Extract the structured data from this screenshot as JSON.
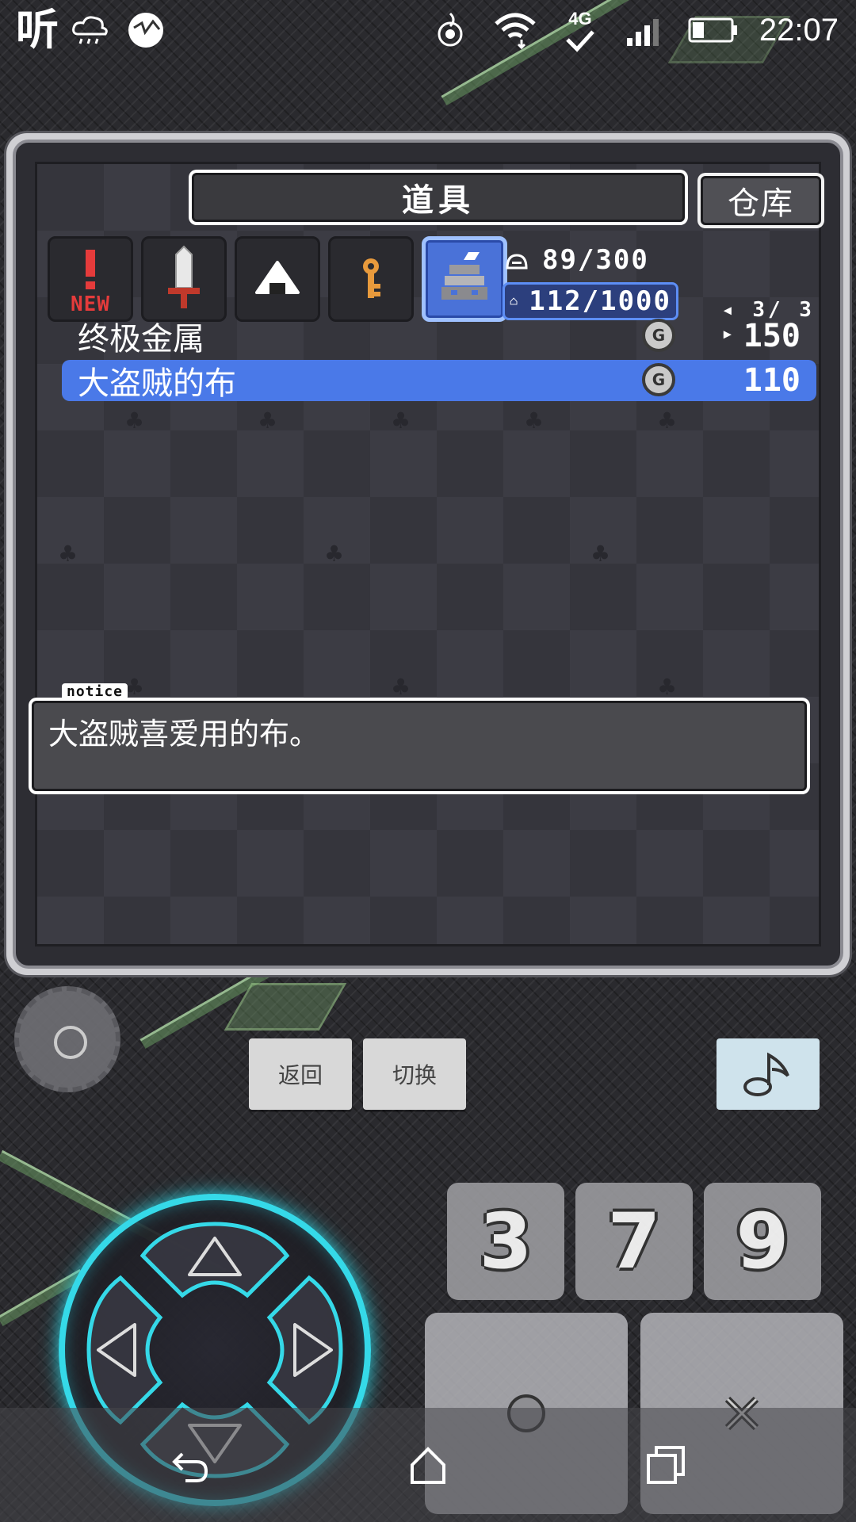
{
  "status_bar": {
    "logo": "听",
    "time": "22:07",
    "network_label": "4G",
    "icons": [
      "weather-icon",
      "avatar-icon",
      "hotspot-icon",
      "wifi-icon",
      "signal-icon",
      "battery-icon"
    ]
  },
  "inventory": {
    "title": "道具",
    "storage_button": "仓库",
    "tabs": [
      {
        "name": "new",
        "icon": "exclamation-icon",
        "badge": "NEW"
      },
      {
        "name": "weapons",
        "icon": "sword-icon"
      },
      {
        "name": "food",
        "icon": "riceball-icon"
      },
      {
        "name": "keys",
        "icon": "key-icon"
      },
      {
        "name": "materials",
        "icon": "anvil-icon",
        "active": true
      }
    ],
    "carry_count": "89/300",
    "storage_count": "112/1000",
    "page_indicator": "3/ 3",
    "items": [
      {
        "name": "终极金属",
        "currency_icon": "G",
        "price": "150",
        "selected": false
      },
      {
        "name": "大盗贼的布",
        "currency_icon": "G",
        "price": "110",
        "selected": true
      }
    ],
    "notice_tag": "notice",
    "notice_text": "大盗贼喜爱用的布。"
  },
  "controls": {
    "back_button": "返回",
    "switch_button": "切换",
    "num_buttons": [
      "3",
      "7",
      "9"
    ],
    "action_buttons": [
      "circle-icon",
      "cross-icon"
    ],
    "music_icon": "music-note-icon"
  },
  "colors": {
    "accent_blue": "#4a79e8",
    "dpad_glow": "#35d9e8",
    "new_red": "#e53b3b"
  }
}
